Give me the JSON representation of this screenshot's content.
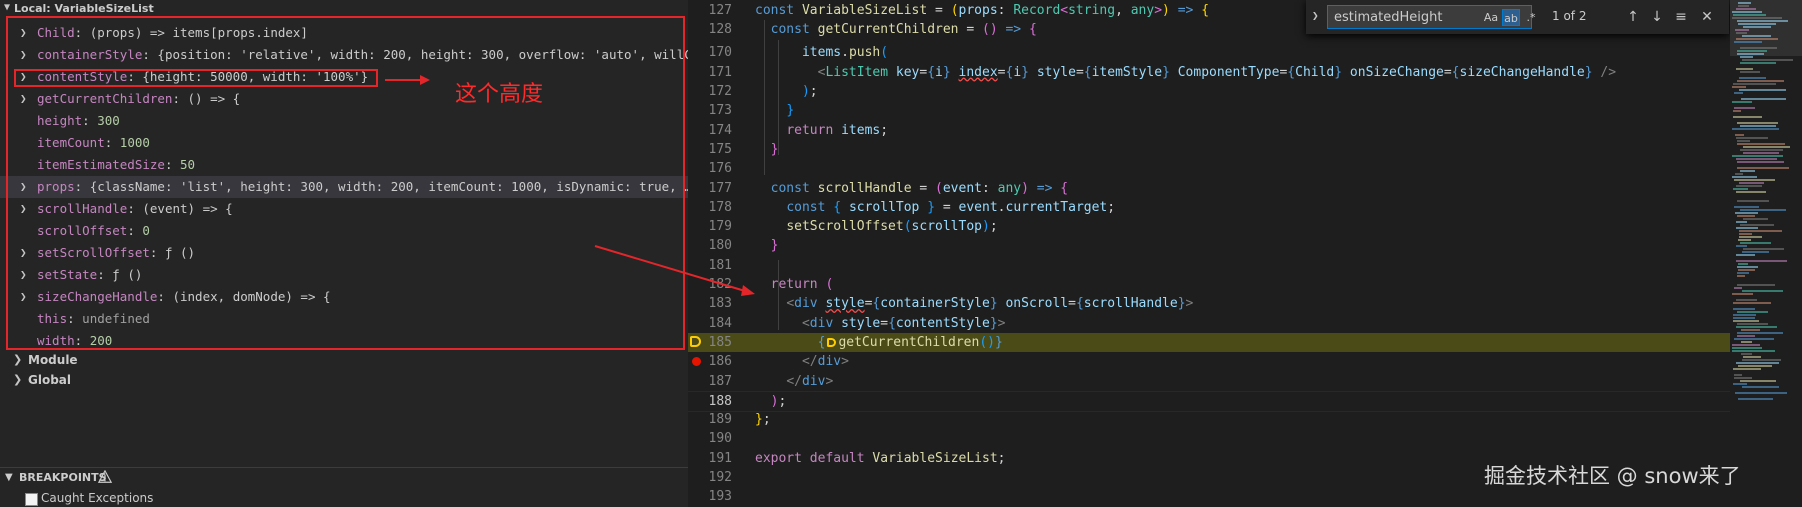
{
  "scope": {
    "section_label": "Local: VariableSizeList",
    "vars": [
      {
        "name": "Child",
        "sep": ": ",
        "value": "(props) => items[props.index]",
        "expandable": true,
        "kind": "fn"
      },
      {
        "name": "containerStyle",
        "sep": ": ",
        "value": "{position: 'relative', width: 200, height: 300, overflow: 'auto', willChan…",
        "expandable": true,
        "kind": "obj"
      },
      {
        "name": "contentStyle",
        "sep": ": ",
        "value": "{height: 50000, width: '100%'}",
        "expandable": true,
        "kind": "obj"
      },
      {
        "name": "getCurrentChildren",
        "sep": ": ",
        "value": "() => {",
        "expandable": true,
        "kind": "fn"
      },
      {
        "name": "height",
        "sep": ": ",
        "value": "300",
        "expandable": false,
        "kind": "num"
      },
      {
        "name": "itemCount",
        "sep": ": ",
        "value": "1000",
        "expandable": false,
        "kind": "num"
      },
      {
        "name": "itemEstimatedSize",
        "sep": ": ",
        "value": "50",
        "expandable": false,
        "kind": "num"
      },
      {
        "name": "props",
        "sep": ": ",
        "value": "{className: 'list', height: 300, width: 200, itemCount: 1000, isDynamic: true, …}",
        "expandable": true,
        "kind": "obj",
        "selected": true
      },
      {
        "name": "scrollHandle",
        "sep": ": ",
        "value": "(event) => {",
        "expandable": true,
        "kind": "fn"
      },
      {
        "name": "scrollOffset",
        "sep": ": ",
        "value": "0",
        "expandable": false,
        "kind": "num"
      },
      {
        "name": "setScrollOffset",
        "sep": ": ",
        "value": "ƒ ()",
        "expandable": true,
        "kind": "fn"
      },
      {
        "name": "setState",
        "sep": ": ",
        "value": "ƒ ()",
        "expandable": true,
        "kind": "fn"
      },
      {
        "name": "sizeChangeHandle",
        "sep": ": ",
        "value": "(index, domNode) => {",
        "expandable": true,
        "kind": "fn"
      },
      {
        "name": "this",
        "sep": ": ",
        "value": "undefined",
        "expandable": false,
        "kind": "undef"
      },
      {
        "name": "width",
        "sep": ": ",
        "value": "200",
        "expandable": false,
        "kind": "num"
      }
    ],
    "other_scopes": [
      "Module",
      "Global"
    ]
  },
  "breakpoints": {
    "header": "BREAKPOINTS",
    "items": [
      {
        "label": "Caught Exceptions",
        "checked": false
      }
    ]
  },
  "annotation": {
    "text": "这个高度"
  },
  "find": {
    "query": "estimatedHeight",
    "match_case": "Aa",
    "whole_word": "ab",
    "regex": ".*",
    "count": "1 of 2",
    "prev": "↑",
    "next": "↓",
    "selection": "≡",
    "close": "✕"
  },
  "editor": {
    "active_line": "188",
    "highlight_line": "185",
    "lines": [
      {
        "n": "127",
        "html": "<span class=\"k\">const</span> <span class=\"fn\">VariableSizeList</span> = <span class=\"br\">(</span><span class=\"vr\">props</span>: <span class=\"ty\">Record</span><span class=\"br2\">&lt;</span><span class=\"ty\">string</span>, <span class=\"ty\">any</span><span class=\"br2\">&gt;</span><span class=\"br\">)</span> <span class=\"k\">=&gt;</span> <span class=\"br\">{</span>"
      },
      {
        "n": "128",
        "html": "  <span class=\"k\">const</span> <span class=\"fn\">getCurrentChildren</span> = <span class=\"br2\">()</span> <span class=\"k\">=&gt;</span> <span class=\"br2\">{</span>"
      },
      {
        "n": "170",
        "html": "      <span class=\"vr\">items</span>.<span class=\"fn\">push</span><span class=\"br3\">(</span>"
      },
      {
        "n": "171",
        "html": "        <span class=\"gy\">&lt;</span><span class=\"ty\">ListItem</span> <span class=\"at\">key</span>=<span class=\"k\">{</span><span class=\"vr\">i</span><span class=\"k\">}</span> <span class=\"at sq\">index</span>=<span class=\"k\">{</span><span class=\"vr\">i</span><span class=\"k\">}</span> <span class=\"at\">style</span>=<span class=\"k\">{</span><span class=\"vr\">itemStyle</span><span class=\"k\">}</span> <span class=\"at\">ComponentType</span>=<span class=\"k\">{</span><span class=\"vr\">Child</span><span class=\"k\">}</span> <span class=\"at\">onSizeChange</span>=<span class=\"k\">{</span><span class=\"vr\">sizeChangeHandle</span><span class=\"k\">}</span> <span class=\"gy\">/&gt;</span>"
      },
      {
        "n": "172",
        "html": "      <span class=\"br3\">)</span>;"
      },
      {
        "n": "173",
        "html": "    <span class=\"br3\">}</span>"
      },
      {
        "n": "174",
        "html": "    <span class=\"k2\">return</span> <span class=\"vr\">items</span>;"
      },
      {
        "n": "175",
        "html": "  <span class=\"br2\">}</span>"
      },
      {
        "n": "176",
        "html": ""
      },
      {
        "n": "177",
        "html": "  <span class=\"k\">const</span> <span class=\"fn\">scrollHandle</span> = <span class=\"br2\">(</span><span class=\"vr\">event</span>: <span class=\"ty\">any</span><span class=\"br2\">)</span> <span class=\"k\">=&gt;</span> <span class=\"br2\">{</span>"
      },
      {
        "n": "178",
        "html": "    <span class=\"k\">const</span> <span class=\"br3\">{</span> <span class=\"vr\">scrollTop</span> <span class=\"br3\">}</span> = <span class=\"vr\">event</span>.<span class=\"vr\">currentTarget</span>;"
      },
      {
        "n": "179",
        "html": "    <span class=\"fn\">setScrollOffset</span><span class=\"br3\">(</span><span class=\"vr\">scrollTop</span><span class=\"br3\">)</span>;"
      },
      {
        "n": "180",
        "html": "  <span class=\"br2\">}</span>"
      },
      {
        "n": "181",
        "html": ""
      },
      {
        "n": "182",
        "html": "  <span class=\"k2\">return</span> <span class=\"br2\">(</span>"
      },
      {
        "n": "183",
        "html": "    <span class=\"gy\">&lt;</span><span class=\"tg\">div</span> <span class=\"at sq\">style</span>=<span class=\"k\">{</span><span class=\"vr\">containerStyle</span><span class=\"k\">}</span> <span class=\"at\">onScroll</span>=<span class=\"k\">{</span><span class=\"vr\">scrollHandle</span><span class=\"k\">}</span><span class=\"gy\">&gt;</span>"
      },
      {
        "n": "184",
        "html": "      <span class=\"gy\">&lt;</span><span class=\"tg\">div</span> <span class=\"at\">style</span>=<span class=\"k\">{</span><span class=\"vr\">contentStyle</span><span class=\"k\">}</span><span class=\"gy\">&gt;</span>"
      },
      {
        "n": "185",
        "html": "        <span class=\"k\">{</span><span class=\"inline-bp\"></span><span class=\"fn\">getCurrentChildren</span><span class=\"br3\">()</span><span class=\"k\">}</span>"
      },
      {
        "n": "186",
        "html": "      <span class=\"gy\">&lt;/</span><span class=\"tg\">div</span><span class=\"gy\">&gt;</span>"
      },
      {
        "n": "187",
        "html": "    <span class=\"gy\">&lt;/</span><span class=\"tg\">div</span><span class=\"gy\">&gt;</span>"
      },
      {
        "n": "188",
        "html": "  <span class=\"br2\">)</span>;"
      },
      {
        "n": "189",
        "html": "<span class=\"br\">}</span>;"
      },
      {
        "n": "190",
        "html": ""
      },
      {
        "n": "191",
        "html": "<span class=\"k2\">export</span> <span class=\"k2\">default</span> <span class=\"fn\">VariableSizeList</span>;"
      },
      {
        "n": "192",
        "html": ""
      },
      {
        "n": "193",
        "html": ""
      }
    ]
  },
  "watermark": "掘金技术社区 @ snow来了",
  "colors": {
    "annotation_red": "#e3262a",
    "breakpoint_red": "#e51400",
    "paused_yellow": "#ffcc00",
    "highlight_line_bg": "#4b4b18"
  }
}
